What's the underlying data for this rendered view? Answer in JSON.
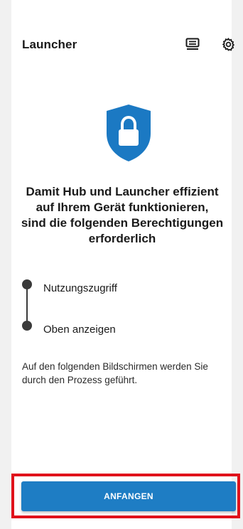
{
  "header": {
    "title": "Launcher",
    "news_icon": "news-feed-icon",
    "settings_icon": "gear-icon"
  },
  "hero": {
    "icon": "shield-lock-icon",
    "shield_color": "#1b79c3"
  },
  "headline": {
    "line1": "Damit Hub und Launcher effizient",
    "line2": "auf Ihrem Gerät funktionieren,",
    "line3": "sind die folgenden Berechtigungen",
    "line4": "erforderlich"
  },
  "permissions": [
    {
      "label": "Nutzungszugriff"
    },
    {
      "label": "Oben anzeigen"
    }
  ],
  "info": {
    "line1": "Auf den folgenden Bildschirmen werden Sie",
    "line2": "durch den Prozess geführt."
  },
  "cta": {
    "label": "ANFANGEN",
    "color": "#1e7dc4",
    "highlight_color": "#e0121b"
  }
}
